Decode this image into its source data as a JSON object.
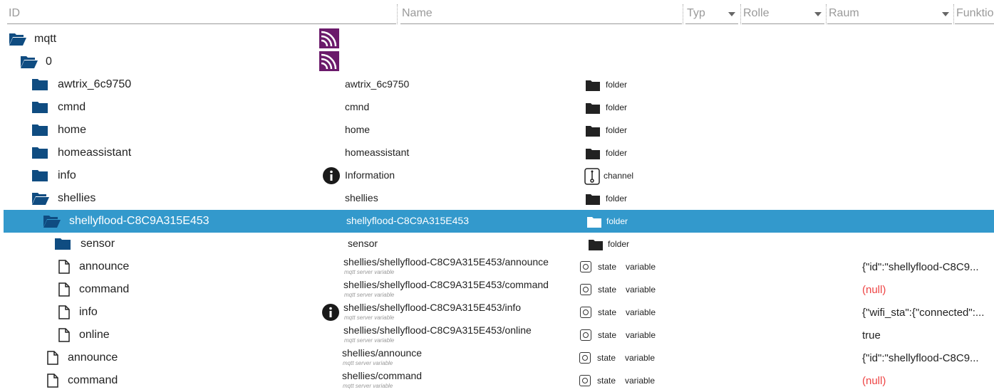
{
  "header": {
    "id_placeholder": "ID",
    "name_placeholder": "Name",
    "type_label": "Typ",
    "role_label": "Rolle",
    "room_label": "Raum",
    "function_label": "Funktio"
  },
  "rows": [
    {
      "id": "mqtt",
      "name": "",
      "type": "",
      "role": "",
      "value": ""
    },
    {
      "id": "0",
      "name": "",
      "type": "",
      "role": "",
      "value": ""
    },
    {
      "id": "awtrix_6c9750",
      "name": "awtrix_6c9750",
      "type": "folder",
      "role": "",
      "value": ""
    },
    {
      "id": "cmnd",
      "name": "cmnd",
      "type": "folder",
      "role": "",
      "value": ""
    },
    {
      "id": "home",
      "name": "home",
      "type": "folder",
      "role": "",
      "value": ""
    },
    {
      "id": "homeassistant",
      "name": "homeassistant",
      "type": "folder",
      "role": "",
      "value": ""
    },
    {
      "id": "info",
      "name": "Information",
      "type": "channel",
      "role": "",
      "value": ""
    },
    {
      "id": "shellies",
      "name": "shellies",
      "type": "folder",
      "role": "",
      "value": ""
    },
    {
      "id": "shellyflood-C8C9A315E453",
      "name": "shellyflood-C8C9A315E453",
      "type": "folder",
      "role": "",
      "value": ""
    },
    {
      "id": "sensor",
      "name": "sensor",
      "type": "folder",
      "role": "",
      "value": ""
    },
    {
      "id": "announce",
      "name": "shellies/shellyflood-C8C9A315E453/announce",
      "sub": "mqtt server variable",
      "type": "state",
      "role": "variable",
      "value": "{\"id\":\"shellyflood-C8C9..."
    },
    {
      "id": "command",
      "name": "shellies/shellyflood-C8C9A315E453/command",
      "sub": "mqtt server variable",
      "type": "state",
      "role": "variable",
      "value": "(null)"
    },
    {
      "id": "info",
      "name": "shellies/shellyflood-C8C9A315E453/info",
      "sub": "mqtt server variable",
      "type": "state",
      "role": "variable",
      "value": "{\"wifi_sta\":{\"connected\":..."
    },
    {
      "id": "online",
      "name": "shellies/shellyflood-C8C9A315E453/online",
      "sub": "mqtt server variable",
      "type": "state",
      "role": "variable",
      "value": "true"
    },
    {
      "id": "announce",
      "name": "shellies/announce",
      "sub": "mqtt server variable",
      "type": "state",
      "role": "variable",
      "value": "{\"id\":\"shellyflood-C8C9..."
    },
    {
      "id": "command",
      "name": "shellies/command",
      "sub": "mqtt server variable",
      "type": "state",
      "role": "variable",
      "value": "(null)"
    }
  ],
  "colors": {
    "folder": "#0f4c81",
    "selection": "#3399cc",
    "mqtt_icon": "#6b1a6b",
    "null_value": "#ee4444"
  }
}
